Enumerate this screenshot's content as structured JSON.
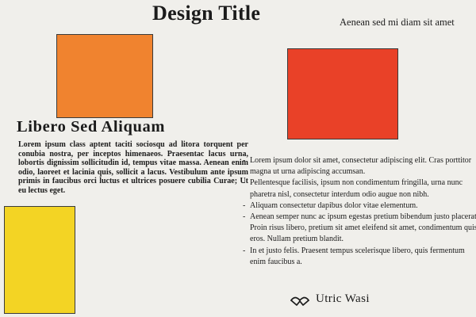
{
  "header": {
    "title": "Design Title",
    "tagline": "Aenean sed mi diam sit amet"
  },
  "blocks": {
    "orange_color": "#f0832f",
    "red_color": "#e94128",
    "yellow_color": "#f3d424"
  },
  "section": {
    "heading": "Libero Sed Aliquam",
    "body": "Lorem ipsum class aptent taciti sociosqu ad litora torquent per conubia nostra, per inceptos himenaeos. Praesentac lacus urna, lobortis dignissim sollicitudin id, tempus vitae massa. Aenean enim odio, laoreet et lacinia quis, sollicit a lacus. Vestibulum ante ipsum primis in faucibus orci luctus et ultrices posuere cubilia Curae; Ut eu lectus eget."
  },
  "bullets": [
    "Lorem ipsum dolor sit amet, consectetur adipiscing elit. Cras porttitor magna ut urna adipiscing accumsan.",
    "Pellentesque facilisis, ipsum non condimentum fringilla, urna nunc pharetra nisl, consectetur interdum odio augue non nibh.",
    "Aliquam consectetur dapibus dolor vitae elementum.",
    "Aenean semper nunc ac ipsum egestas pretium bibendum justo placerat. Proin risus libero, pretium sit amet eleifend sit amet, condimentum quis eros. Nullam pretium blandit.",
    "In et justo felis. Praesent tempus scelerisque libero, quis fermentum enim faucibus a."
  ],
  "brand": {
    "name": "Utric Wasi",
    "icon": "wave-logo-icon"
  }
}
